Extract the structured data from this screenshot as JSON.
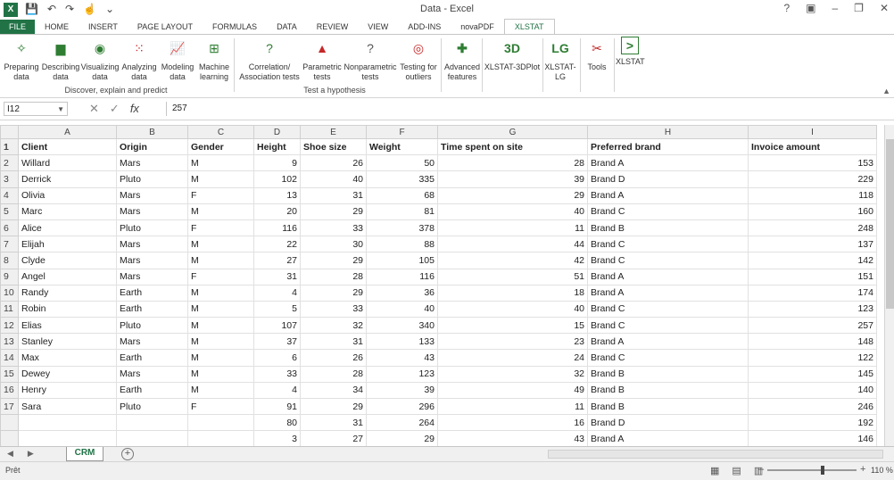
{
  "window": {
    "title": "Data - Excel"
  },
  "ribbon_tabs": [
    "FILE",
    "HOME",
    "INSERT",
    "PAGE LAYOUT",
    "FORMULAS",
    "DATA",
    "REVIEW",
    "VIEW",
    "ADD-INS",
    "novaPDF",
    "XLSTAT"
  ],
  "ribbon_buttons": [
    {
      "label": "Preparing data",
      "icon": "preparing-data-icon"
    },
    {
      "label": "Describing data",
      "icon": "bar-chart-icon"
    },
    {
      "label": "Visualizing data",
      "icon": "eye-icon"
    },
    {
      "label": "Analyzing data",
      "icon": "scatter-icon"
    },
    {
      "label": "Modeling data",
      "icon": "line-chart-icon"
    },
    {
      "label": "Machine learning",
      "icon": "network-icon"
    },
    {
      "label": "Correlation/ Association tests",
      "icon": "question-icon"
    },
    {
      "label": "Parametric tests",
      "icon": "bell-curve-icon"
    },
    {
      "label": "Nonparametric tests",
      "icon": "question-icon"
    },
    {
      "label": "Testing for outliers",
      "icon": "target-icon"
    },
    {
      "label": "Advanced features",
      "icon": "plus-icon"
    },
    {
      "label": "XLSTAT-3DPlot",
      "icon": "3d-icon"
    },
    {
      "label": "XLSTAT- LG",
      "icon": "lg-icon"
    },
    {
      "label": "Tools",
      "icon": "tools-icon"
    },
    {
      "label": "XLSTAT",
      "icon": "xlstat-icon"
    }
  ],
  "ribbon_groups": [
    "Discover, explain and predict",
    "Test a hypothesis"
  ],
  "formula_bar": {
    "cell": "I12",
    "value": "257"
  },
  "columns": [
    "A",
    "B",
    "C",
    "D",
    "E",
    "F",
    "G",
    "H",
    "I"
  ],
  "header": [
    "Client",
    "Origin",
    "Gender",
    "Height",
    "Shoe size",
    "Weight",
    "Time spent on site",
    "Preferred brand",
    "Invoice amount"
  ],
  "rows": [
    [
      "Willard",
      "Mars",
      "M",
      "9",
      "26",
      "50",
      "28",
      "Brand A",
      "153"
    ],
    [
      "Derrick",
      "Pluto",
      "M",
      "102",
      "40",
      "335",
      "39",
      "Brand D",
      "229"
    ],
    [
      "Olivia",
      "Mars",
      "F",
      "13",
      "31",
      "68",
      "29",
      "Brand A",
      "118"
    ],
    [
      "Marc",
      "Mars",
      "M",
      "20",
      "29",
      "81",
      "40",
      "Brand C",
      "160"
    ],
    [
      "Alice",
      "Pluto",
      "F",
      "116",
      "33",
      "378",
      "11",
      "Brand B",
      "248"
    ],
    [
      "Elijah",
      "Mars",
      "M",
      "22",
      "30",
      "88",
      "44",
      "Brand C",
      "137"
    ],
    [
      "Clyde",
      "Mars",
      "M",
      "27",
      "29",
      "105",
      "42",
      "Brand C",
      "142"
    ],
    [
      "Angel",
      "Mars",
      "F",
      "31",
      "28",
      "116",
      "51",
      "Brand A",
      "151"
    ],
    [
      "Randy",
      "Earth",
      "M",
      "4",
      "29",
      "36",
      "18",
      "Brand A",
      "174"
    ],
    [
      "Robin",
      "Earth",
      "M",
      "5",
      "33",
      "40",
      "40",
      "Brand C",
      "123"
    ],
    [
      "Elias",
      "Pluto",
      "M",
      "107",
      "32",
      "340",
      "15",
      "Brand C",
      "257"
    ],
    [
      "Stanley",
      "Mars",
      "M",
      "37",
      "31",
      "133",
      "23",
      "Brand A",
      "148"
    ],
    [
      "Max",
      "Earth",
      "M",
      "6",
      "26",
      "43",
      "24",
      "Brand C",
      "122"
    ],
    [
      "Dewey",
      "Mars",
      "M",
      "33",
      "28",
      "123",
      "32",
      "Brand B",
      "145"
    ],
    [
      "Henry",
      "Earth",
      "M",
      "4",
      "34",
      "39",
      "49",
      "Brand B",
      "140"
    ],
    [
      "Sara",
      "Pluto",
      "F",
      "91",
      "29",
      "296",
      "11",
      "Brand B",
      "246"
    ],
    [
      "",
      "",
      "",
      "80",
      "31",
      "264",
      "16",
      "Brand D",
      "192"
    ],
    [
      "",
      "",
      "",
      "3",
      "27",
      "29",
      "43",
      "Brand A",
      "146"
    ]
  ],
  "row_numbers": [
    "1",
    "2",
    "3",
    "4",
    "5",
    "6",
    "7",
    "8",
    "9",
    "10",
    "11",
    "12",
    "13",
    "14",
    "15",
    "16",
    "17",
    "",
    "",
    ""
  ],
  "sheet_tab": "CRM",
  "status": {
    "ready": "Prêt",
    "zoom": "110 %"
  }
}
